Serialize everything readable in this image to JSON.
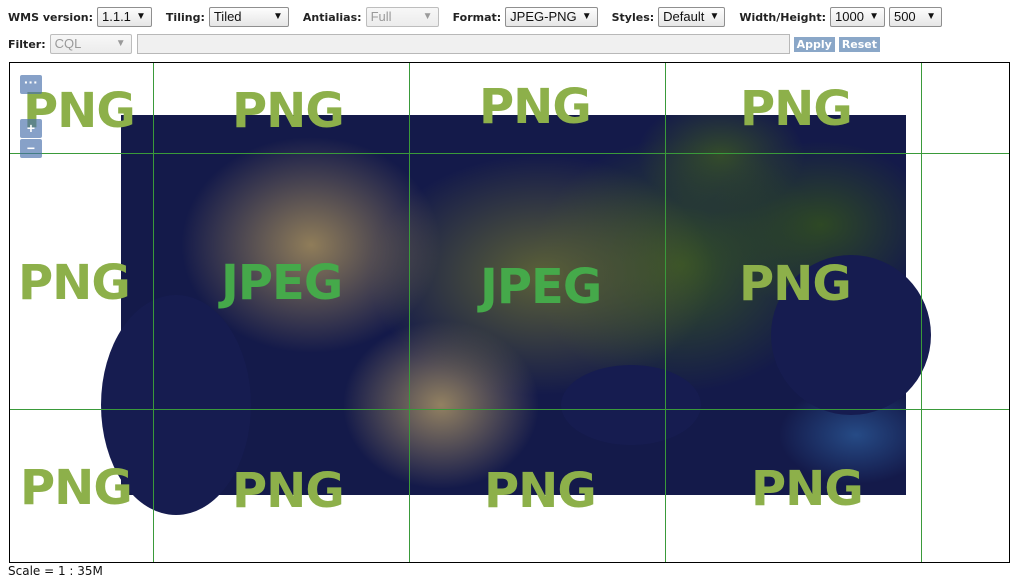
{
  "toolbar": {
    "wms_version": {
      "label": "WMS version:",
      "value": "1.1.1"
    },
    "tiling": {
      "label": "Tiling:",
      "value": "Tiled"
    },
    "antialias": {
      "label": "Antialias:",
      "value": "Full"
    },
    "format": {
      "label": "Format:",
      "value": "JPEG-PNG"
    },
    "styles": {
      "label": "Styles:",
      "value": "Default"
    },
    "size": {
      "label": "Width/Height:",
      "width": "1000",
      "height": "500"
    },
    "dropdown_icon": "chevron-down-icon"
  },
  "filter": {
    "label": "Filter:",
    "type": "CQL",
    "value": "",
    "apply_label": "Apply",
    "reset_label": "Reset"
  },
  "map": {
    "controls": {
      "menu": "···",
      "zoom_in": "+",
      "zoom_out": "−"
    },
    "tiles": [
      [
        "PNG",
        "PNG",
        "PNG",
        "PNG"
      ],
      [
        "PNG",
        "JPEG",
        "JPEG",
        "PNG"
      ],
      [
        "PNG",
        "PNG",
        "PNG",
        "PNG"
      ]
    ],
    "colors": {
      "png_label": "#8db04a",
      "jpeg_label": "#45a94a",
      "grid_line": "#3a9a3a",
      "ocean": "#141a4a"
    }
  },
  "scale": "Scale = 1 : 35M"
}
